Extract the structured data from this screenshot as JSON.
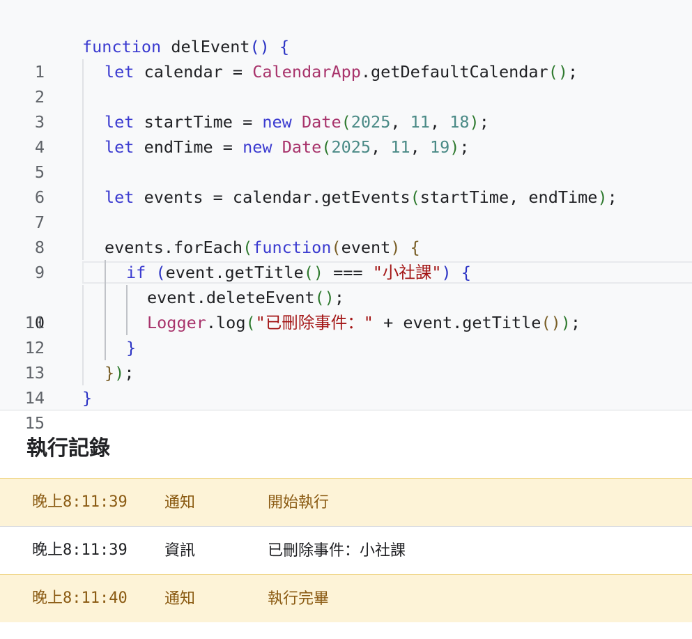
{
  "editor": {
    "line_numbers": [
      "1",
      "2",
      "3",
      "4",
      "5",
      "6",
      "7",
      "8",
      "9",
      "10",
      "11",
      "12",
      "13",
      "14",
      "15"
    ],
    "active_line": "10",
    "tokens": {
      "l1_kw": "function",
      "l1_name": " delEvent",
      "l1_paren": "()",
      "l1_brace": " {",
      "l2_kw": "let",
      "l2_a": " calendar = ",
      "l2_cls": "CalendarApp",
      "l2_b": ".getDefaultCalendar",
      "l2_paren": "()",
      "l2_semi": ";",
      "l4_kw": "let",
      "l4_a": " startTime = ",
      "l4_new": "new",
      "l4_sp": " ",
      "l4_cls": "Date",
      "l4_po": "(",
      "l4_n1": "2025",
      "l4_c1": ", ",
      "l4_n2": "11",
      "l4_c2": ", ",
      "l4_n3": "18",
      "l4_pc": ")",
      "l4_semi": ";",
      "l5_kw": "let",
      "l5_a": " endTime = ",
      "l5_new": "new",
      "l5_sp": " ",
      "l5_cls": "Date",
      "l5_po": "(",
      "l5_n1": "2025",
      "l5_c1": ", ",
      "l5_n2": "11",
      "l5_c2": ", ",
      "l5_n3": "19",
      "l5_pc": ")",
      "l5_semi": ";",
      "l7_kw": "let",
      "l7_a": " events = calendar.getEvents",
      "l7_po": "(",
      "l7_b": "startTime, endTime",
      "l7_pc": ")",
      "l7_semi": ";",
      "l9_a": "events.forEach",
      "l9_po": "(",
      "l9_kw": "function",
      "l9_po2": "(",
      "l9_b": "event",
      "l9_pc2": ")",
      "l9_brace": " {",
      "l10_kw": "if",
      "l10_sp": " ",
      "l10_po": "(",
      "l10_a": "event.getTitle",
      "l10_pp": "()",
      "l10_b": " === ",
      "l10_str": "\"小社課\"",
      "l10_pc": ")",
      "l10_brace": " {",
      "l11_a": "event.deleteEvent",
      "l11_pp": "()",
      "l11_semi": ";",
      "l12_cls": "Logger",
      "l12_a": ".log",
      "l12_po": "(",
      "l12_str": "\"已刪除事件：\"",
      "l12_b": " + event.getTitle",
      "l12_pp": "()",
      "l12_pc": ")",
      "l12_semi": ";",
      "l13_brace": "}",
      "l14_brace": "}",
      "l14_pc": ")",
      "l14_semi": ";",
      "l15_brace": "}"
    }
  },
  "log": {
    "title": "執行記錄",
    "rows": [
      {
        "time": "晚上8:11:39",
        "type": "通知",
        "message": "開始執行"
      },
      {
        "time": "晚上8:11:39",
        "type": "資訊",
        "message": "已刪除事件：小社課"
      },
      {
        "time": "晚上8:11:40",
        "type": "通知",
        "message": "執行完畢"
      }
    ]
  },
  "colors": {
    "keyword": "#3b3bd0",
    "class": "#a8336b",
    "number": "#4a8a86",
    "string": "#a31515",
    "notice_bg": "#fdf3d7",
    "notice_text": "#8a5a12"
  }
}
